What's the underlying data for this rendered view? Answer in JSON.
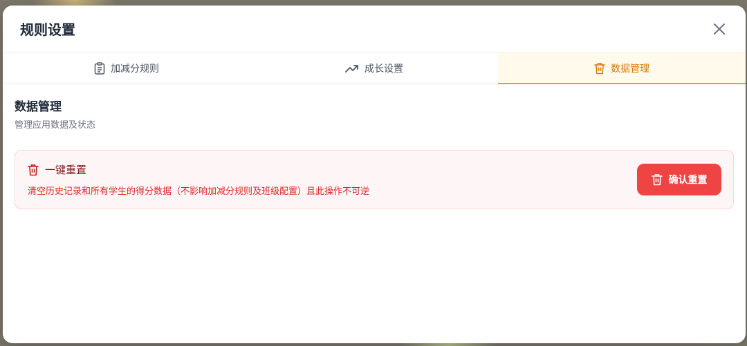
{
  "modal": {
    "title": "规则设置",
    "close_icon": "close-icon"
  },
  "tabs": [
    {
      "label": "加减分规则",
      "icon": "clipboard-icon",
      "active": false
    },
    {
      "label": "成长设置",
      "icon": "trending-up-icon",
      "active": false
    },
    {
      "label": "数据管理",
      "icon": "trash-icon",
      "active": true
    }
  ],
  "section": {
    "title": "数据管理",
    "subtitle": "管理应用数据及状态"
  },
  "reset_card": {
    "icon": "trash-icon",
    "title": "一键重置",
    "description": "清空历史记录和所有学生的得分数据（不影响加减分规则及班级配置）且此操作不可逆",
    "button_label": "确认重置",
    "button_icon": "trash-icon"
  },
  "colors": {
    "accent": "#f59e0b",
    "accent_text": "#d97706",
    "danger": "#ef4444",
    "danger_text": "#dc2626",
    "danger_title": "#7f1d1d"
  }
}
